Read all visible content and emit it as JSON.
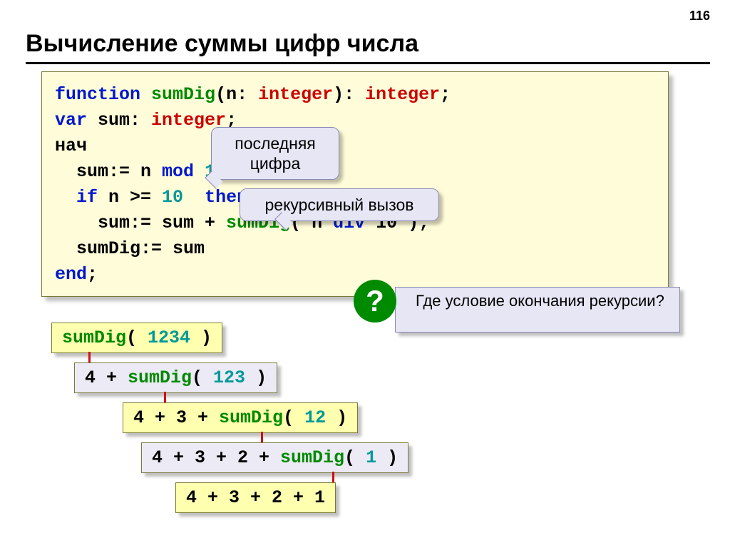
{
  "page_number": "116",
  "title": "Вычисление суммы цифр числа",
  "code": {
    "l1_function": "function",
    "l1_name": " sumDig",
    "l1_paren": "(n: ",
    "l1_type1": "integer",
    "l1_paren2": "): ",
    "l1_type2": "integer",
    "l1_semi": ";",
    "l2_var": "var",
    "l2_sum": " sum: ",
    "l2_type": "integer",
    "l2_semi": ";",
    "l3_nach": "нач",
    "l4_ind": "  sum:= n ",
    "l4_mod": "mod",
    "l4_ten": " 10",
    "l4_semi": ";",
    "l5_ind": "  ",
    "l5_if": "if",
    "l5_cond": " n >= ",
    "l5_ten": "10",
    "l5_sp": "  ",
    "l5_then": "then",
    "l6_ind": "    sum:= sum + ",
    "l6_call": "sumDig",
    "l6_open": "( n ",
    "l6_div": "div",
    "l6_rest": " 10 );",
    "l7": "  sumDig:= sum",
    "l8_end": "end",
    "l8_semi": ";"
  },
  "callouts": {
    "last_digit": "последняя цифра",
    "recursive_call": "рекурсивный вызов"
  },
  "question_badge": "?",
  "question_text": "Где условие окончания рекурсии?",
  "steps": {
    "s1_name": "sumDig",
    "s1_arg": "( ",
    "s1_num": "1234",
    "s1_close": " )",
    "s2_lead": "4 + ",
    "s2_name": "sumDig",
    "s2_arg": "( ",
    "s2_num": "123",
    "s2_close": " )",
    "s3_lead": "4 + 3 + ",
    "s3_name": "sumDig",
    "s3_arg": "( ",
    "s3_num": "12",
    "s3_close": " )",
    "s4_lead": "4 + 3 + 2 + ",
    "s4_name": "sumDig",
    "s4_arg": "( ",
    "s4_num": "1",
    "s4_close": " )",
    "s5": "4 + 3 + 2 + 1"
  }
}
